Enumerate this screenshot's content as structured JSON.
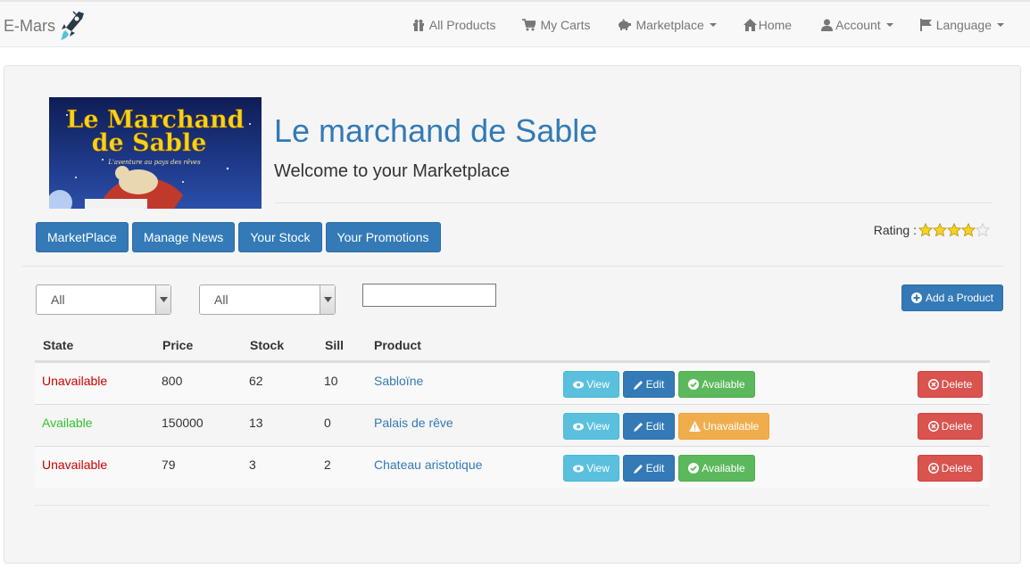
{
  "navbar": {
    "brand": "E-Mars",
    "items": [
      {
        "label": "All Products",
        "icon": "gift-icon"
      },
      {
        "label": "My Carts",
        "icon": "cart-icon"
      },
      {
        "label": "Marketplace",
        "icon": "piggy-bank-icon",
        "dropdown": true
      },
      {
        "label": "Home",
        "icon": "home-icon"
      },
      {
        "label": "Account",
        "icon": "user-icon",
        "dropdown": true
      },
      {
        "label": "Language",
        "icon": "flag-icon",
        "dropdown": true
      }
    ]
  },
  "shop": {
    "image_text_line1": "Le Marchand",
    "image_text_line2": "de Sable",
    "image_tagline": "L'aventure au pays des rêves",
    "title": "Le marchand de Sable",
    "subtitle": "Welcome to your Marketplace"
  },
  "tabs": [
    "MarketPlace",
    "Manage News",
    "Your Stock",
    "Your Promotions"
  ],
  "rating": {
    "label": "Rating :",
    "value": 4,
    "max": 5
  },
  "filters": {
    "state_select": "All",
    "category_select": "All",
    "search_value": ""
  },
  "add_product_label": "Add a Product",
  "table": {
    "headers": {
      "state": "State",
      "price": "Price",
      "stock": "Stock",
      "sill": "Sill",
      "product": "Product"
    },
    "rows": [
      {
        "state": "Unavailable",
        "price": "800",
        "stock": "62",
        "sill": "10",
        "product": "Sabloïne",
        "toggle": "Available"
      },
      {
        "state": "Available",
        "price": "150000",
        "stock": "13",
        "sill": "0",
        "product": "Palais de rêve",
        "toggle": "Unavailable"
      },
      {
        "state": "Unavailable",
        "price": "79",
        "stock": "3",
        "sill": "2",
        "product": "Chateau aristotique",
        "toggle": "Available"
      }
    ],
    "view_label": "View",
    "edit_label": "Edit",
    "delete_label": "Delete"
  },
  "colors": {
    "primary": "#337ab7",
    "info": "#5bc0de",
    "success": "#5cb85c",
    "warning": "#f0ad4e",
    "danger": "#d9534f",
    "unavailable_text": "#cc0000",
    "available_text": "#2ec42e"
  }
}
